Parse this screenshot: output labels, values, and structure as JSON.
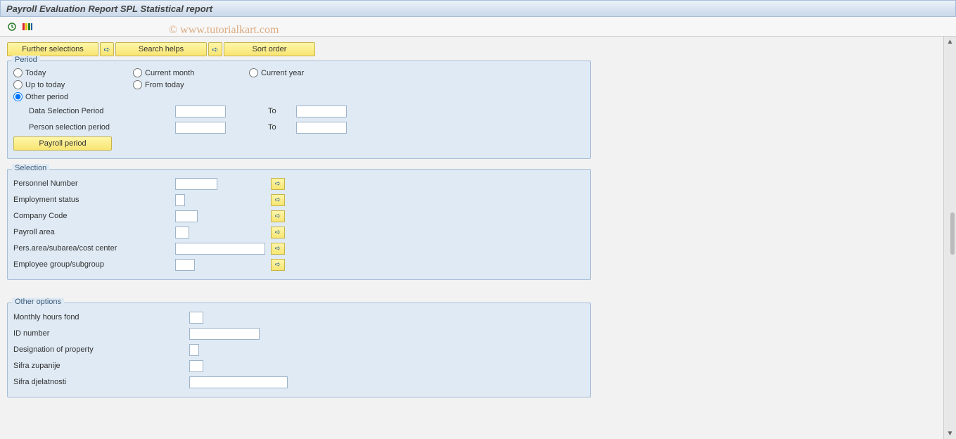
{
  "title": "Payroll Evaluation Report SPL Statistical report",
  "watermark": "© www.tutorialkart.com",
  "toolbar_buttons": {
    "further_selections": "Further selections",
    "search_helps": "Search helps",
    "sort_order": "Sort order"
  },
  "period": {
    "title": "Period",
    "radios": {
      "today": "Today",
      "current_month": "Current month",
      "current_year": "Current year",
      "up_to_today": "Up to today",
      "from_today": "From today",
      "other_period": "Other period"
    },
    "selected": "other_period",
    "data_selection_period": {
      "label": "Data Selection Period",
      "from": "",
      "to_label": "To",
      "to": ""
    },
    "person_selection_period": {
      "label": "Person selection period",
      "from": "",
      "to_label": "To",
      "to": ""
    },
    "payroll_period_btn": "Payroll period"
  },
  "selection": {
    "title": "Selection",
    "personnel_number": {
      "label": "Personnel Number",
      "value": ""
    },
    "employment_status": {
      "label": "Employment status",
      "value": ""
    },
    "company_code": {
      "label": "Company Code",
      "value": ""
    },
    "payroll_area": {
      "label": "Payroll area",
      "value": ""
    },
    "pers_area_subarea": {
      "label": "Pers.area/subarea/cost center",
      "value": ""
    },
    "employee_group": {
      "label": "Employee group/subgroup",
      "value": ""
    }
  },
  "other_options": {
    "title": "Other options",
    "monthly_hours": {
      "label": "Monthly hours fond",
      "value": ""
    },
    "id_number": {
      "label": "ID number",
      "value": ""
    },
    "designation": {
      "label": "Designation of property",
      "value": ""
    },
    "sifra_zupanije": {
      "label": "Sifra zupanije",
      "value": ""
    },
    "sifra_djelatnosti": {
      "label": "Sifra djelatnosti",
      "value": ""
    }
  }
}
